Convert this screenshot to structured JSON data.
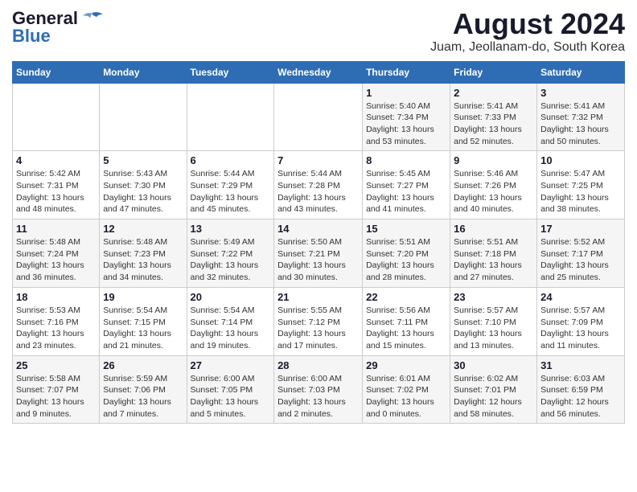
{
  "header": {
    "logo_general": "General",
    "logo_blue": "Blue",
    "title": "August 2024",
    "subtitle": "Juam, Jeollanam-do, South Korea"
  },
  "weekdays": [
    "Sunday",
    "Monday",
    "Tuesday",
    "Wednesday",
    "Thursday",
    "Friday",
    "Saturday"
  ],
  "weeks": [
    [
      {
        "day": "",
        "info": ""
      },
      {
        "day": "",
        "info": ""
      },
      {
        "day": "",
        "info": ""
      },
      {
        "day": "",
        "info": ""
      },
      {
        "day": "1",
        "info": "Sunrise: 5:40 AM\nSunset: 7:34 PM\nDaylight: 13 hours\nand 53 minutes."
      },
      {
        "day": "2",
        "info": "Sunrise: 5:41 AM\nSunset: 7:33 PM\nDaylight: 13 hours\nand 52 minutes."
      },
      {
        "day": "3",
        "info": "Sunrise: 5:41 AM\nSunset: 7:32 PM\nDaylight: 13 hours\nand 50 minutes."
      }
    ],
    [
      {
        "day": "4",
        "info": "Sunrise: 5:42 AM\nSunset: 7:31 PM\nDaylight: 13 hours\nand 48 minutes."
      },
      {
        "day": "5",
        "info": "Sunrise: 5:43 AM\nSunset: 7:30 PM\nDaylight: 13 hours\nand 47 minutes."
      },
      {
        "day": "6",
        "info": "Sunrise: 5:44 AM\nSunset: 7:29 PM\nDaylight: 13 hours\nand 45 minutes."
      },
      {
        "day": "7",
        "info": "Sunrise: 5:44 AM\nSunset: 7:28 PM\nDaylight: 13 hours\nand 43 minutes."
      },
      {
        "day": "8",
        "info": "Sunrise: 5:45 AM\nSunset: 7:27 PM\nDaylight: 13 hours\nand 41 minutes."
      },
      {
        "day": "9",
        "info": "Sunrise: 5:46 AM\nSunset: 7:26 PM\nDaylight: 13 hours\nand 40 minutes."
      },
      {
        "day": "10",
        "info": "Sunrise: 5:47 AM\nSunset: 7:25 PM\nDaylight: 13 hours\nand 38 minutes."
      }
    ],
    [
      {
        "day": "11",
        "info": "Sunrise: 5:48 AM\nSunset: 7:24 PM\nDaylight: 13 hours\nand 36 minutes."
      },
      {
        "day": "12",
        "info": "Sunrise: 5:48 AM\nSunset: 7:23 PM\nDaylight: 13 hours\nand 34 minutes."
      },
      {
        "day": "13",
        "info": "Sunrise: 5:49 AM\nSunset: 7:22 PM\nDaylight: 13 hours\nand 32 minutes."
      },
      {
        "day": "14",
        "info": "Sunrise: 5:50 AM\nSunset: 7:21 PM\nDaylight: 13 hours\nand 30 minutes."
      },
      {
        "day": "15",
        "info": "Sunrise: 5:51 AM\nSunset: 7:20 PM\nDaylight: 13 hours\nand 28 minutes."
      },
      {
        "day": "16",
        "info": "Sunrise: 5:51 AM\nSunset: 7:18 PM\nDaylight: 13 hours\nand 27 minutes."
      },
      {
        "day": "17",
        "info": "Sunrise: 5:52 AM\nSunset: 7:17 PM\nDaylight: 13 hours\nand 25 minutes."
      }
    ],
    [
      {
        "day": "18",
        "info": "Sunrise: 5:53 AM\nSunset: 7:16 PM\nDaylight: 13 hours\nand 23 minutes."
      },
      {
        "day": "19",
        "info": "Sunrise: 5:54 AM\nSunset: 7:15 PM\nDaylight: 13 hours\nand 21 minutes."
      },
      {
        "day": "20",
        "info": "Sunrise: 5:54 AM\nSunset: 7:14 PM\nDaylight: 13 hours\nand 19 minutes."
      },
      {
        "day": "21",
        "info": "Sunrise: 5:55 AM\nSunset: 7:12 PM\nDaylight: 13 hours\nand 17 minutes."
      },
      {
        "day": "22",
        "info": "Sunrise: 5:56 AM\nSunset: 7:11 PM\nDaylight: 13 hours\nand 15 minutes."
      },
      {
        "day": "23",
        "info": "Sunrise: 5:57 AM\nSunset: 7:10 PM\nDaylight: 13 hours\nand 13 minutes."
      },
      {
        "day": "24",
        "info": "Sunrise: 5:57 AM\nSunset: 7:09 PM\nDaylight: 13 hours\nand 11 minutes."
      }
    ],
    [
      {
        "day": "25",
        "info": "Sunrise: 5:58 AM\nSunset: 7:07 PM\nDaylight: 13 hours\nand 9 minutes."
      },
      {
        "day": "26",
        "info": "Sunrise: 5:59 AM\nSunset: 7:06 PM\nDaylight: 13 hours\nand 7 minutes."
      },
      {
        "day": "27",
        "info": "Sunrise: 6:00 AM\nSunset: 7:05 PM\nDaylight: 13 hours\nand 5 minutes."
      },
      {
        "day": "28",
        "info": "Sunrise: 6:00 AM\nSunset: 7:03 PM\nDaylight: 13 hours\nand 2 minutes."
      },
      {
        "day": "29",
        "info": "Sunrise: 6:01 AM\nSunset: 7:02 PM\nDaylight: 13 hours\nand 0 minutes."
      },
      {
        "day": "30",
        "info": "Sunrise: 6:02 AM\nSunset: 7:01 PM\nDaylight: 12 hours\nand 58 minutes."
      },
      {
        "day": "31",
        "info": "Sunrise: 6:03 AM\nSunset: 6:59 PM\nDaylight: 12 hours\nand 56 minutes."
      }
    ]
  ]
}
